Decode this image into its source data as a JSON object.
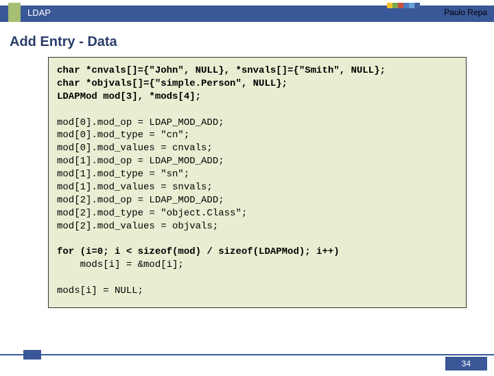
{
  "header": {
    "topic": "LDAP",
    "author": "Paulo Repa"
  },
  "title": "Add Entry - Data",
  "palette": {
    "c1": "#f4c430",
    "c2": "#7ea84f",
    "c3": "#c94f3d",
    "c4": "#4e7cc0",
    "c5": "#6aa0d8",
    "c6": "#4060a0"
  },
  "code": {
    "decl1": "char *cnvals[]={\"John\", NULL}, *snvals[]={\"Smith\", NULL};",
    "decl2": "char *objvals[]={\"simple.Person\", NULL};",
    "decl3": "LDAPMod mod[3], *mods[4];",
    "body": "mod[0].mod_op = LDAP_MOD_ADD;\nmod[0].mod_type = \"cn\";\nmod[0].mod_values = cnvals;\nmod[1].mod_op = LDAP_MOD_ADD;\nmod[1].mod_type = \"sn\";\nmod[1].mod_values = snvals;\nmod[2].mod_op = LDAP_MOD_ADD;\nmod[2].mod_type = \"object.Class\";\nmod[2].mod_values = objvals;",
    "loop1": "for (i=0; i < sizeof(mod) / sizeof(LDAPMod); i++)",
    "loop2": "    mods[i] = &mod[i];",
    "tail": "mods[i] = NULL;"
  },
  "page": "34"
}
